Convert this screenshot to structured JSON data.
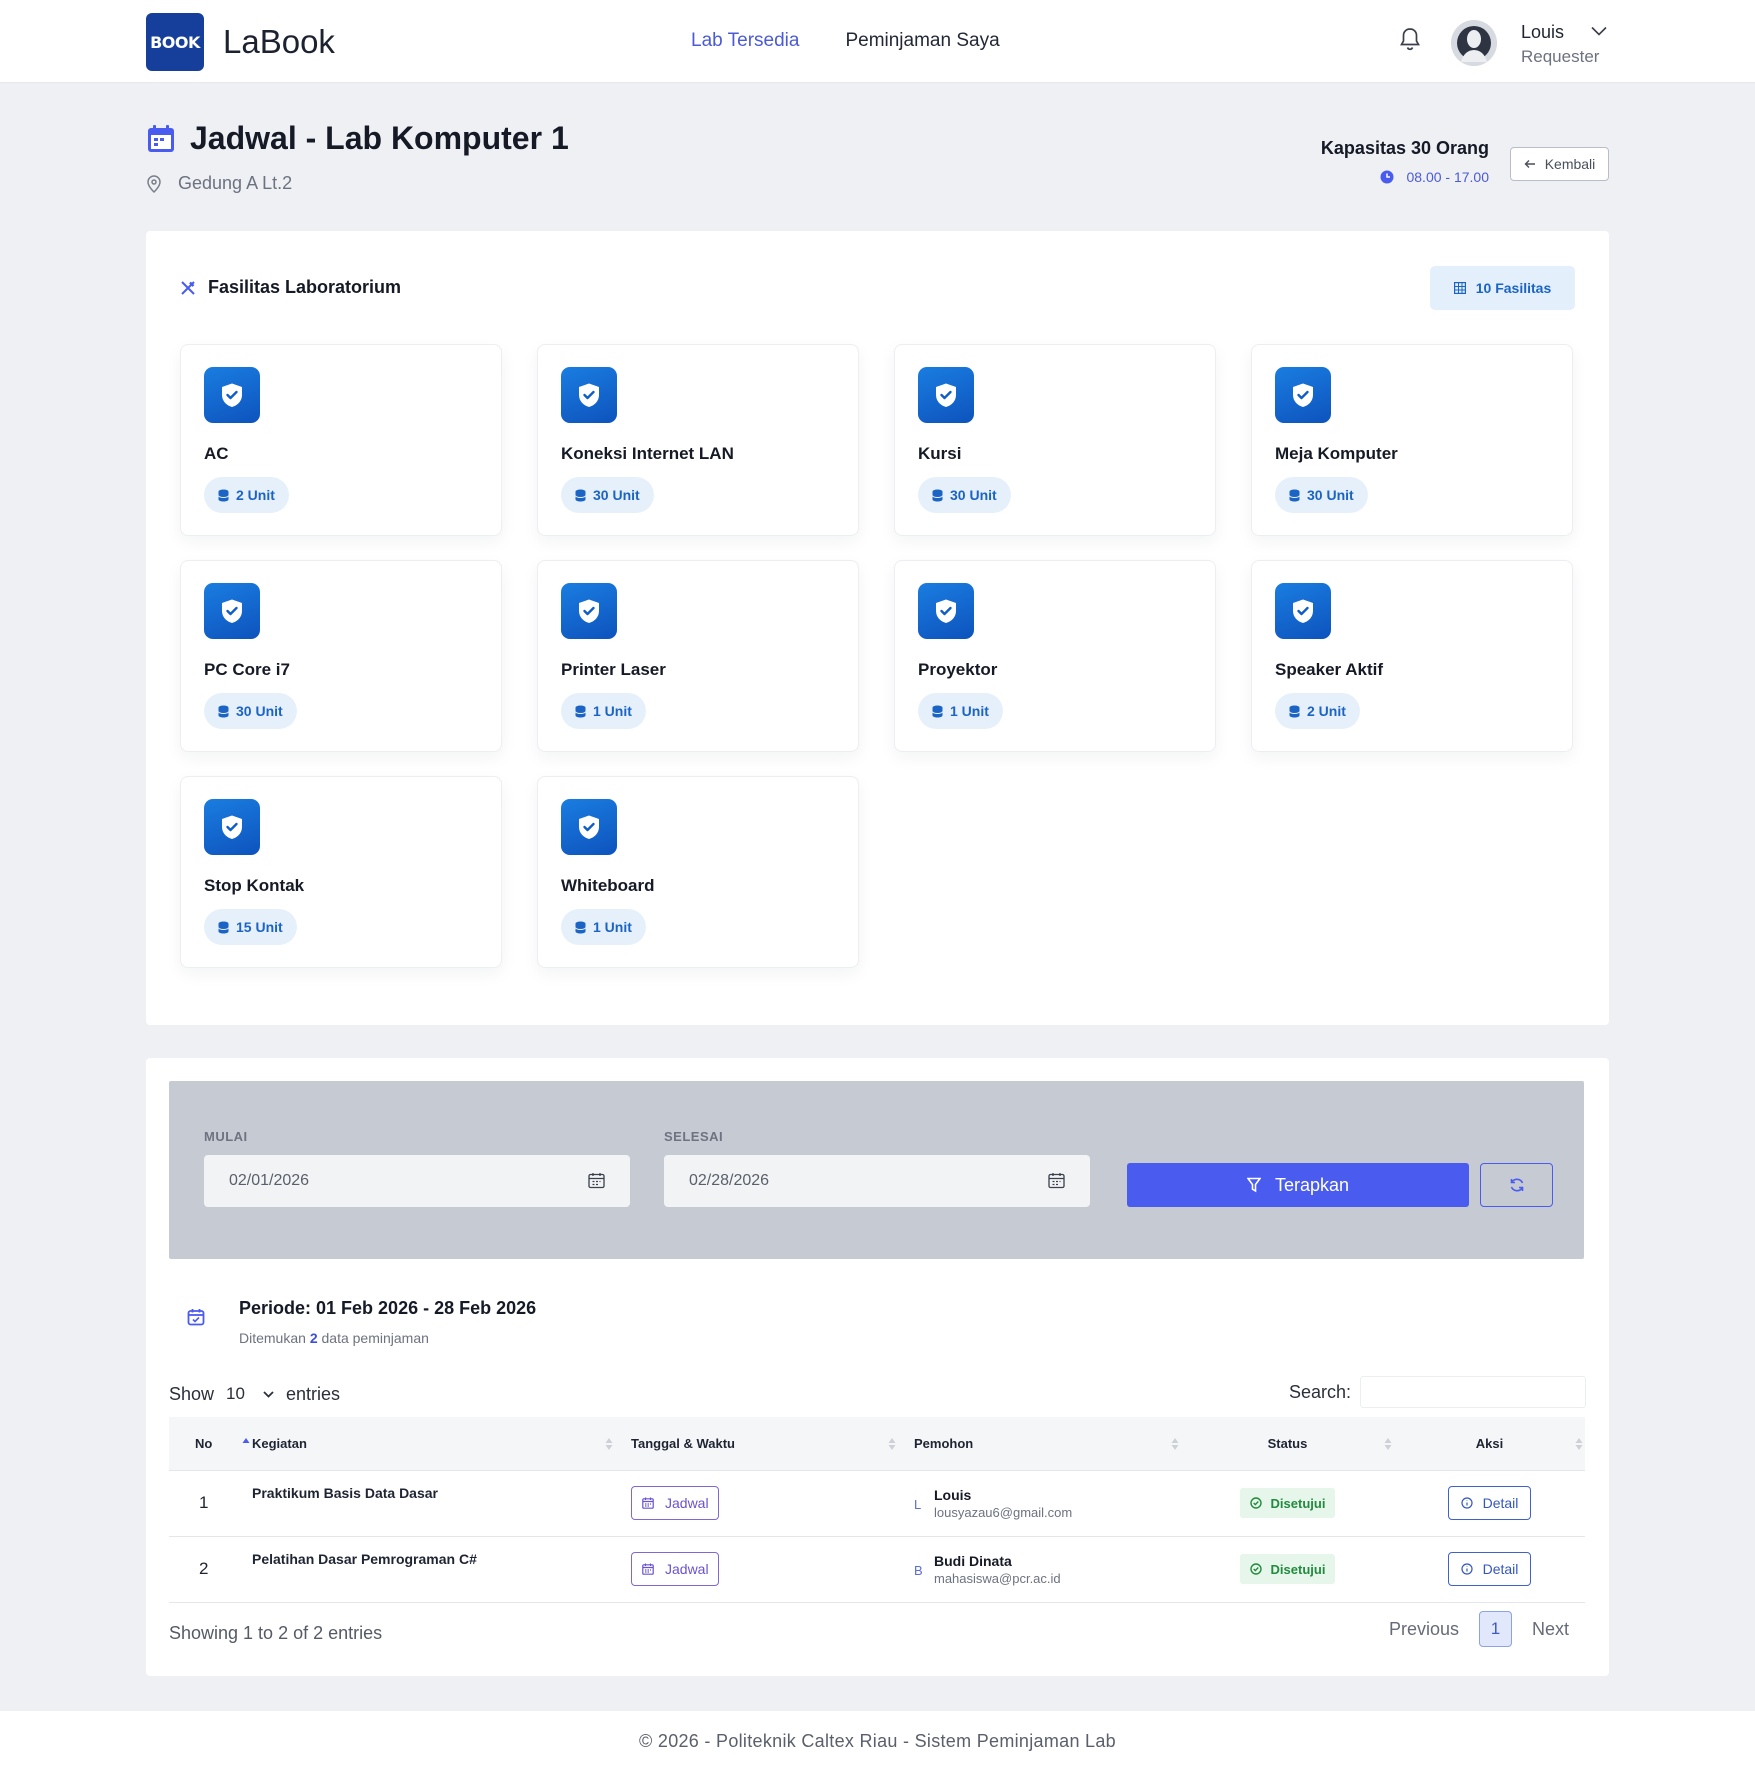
{
  "app": {
    "logo_text": "BOOK",
    "name": "LaBook"
  },
  "nav": {
    "links": [
      {
        "label": "Lab Tersedia",
        "active": true
      },
      {
        "label": "Peminjaman Saya",
        "active": false
      }
    ]
  },
  "user": {
    "name": "Louis",
    "role": "Requester"
  },
  "header": {
    "title": "Jadwal - Lab Komputer 1",
    "location": "Gedung A Lt.2",
    "capacity": "Kapasitas 30 Orang",
    "hours": "08.00 - 17.00",
    "back_label": "Kembali"
  },
  "facilities": {
    "title": "Fasilitas Laboratorium",
    "count_label": "10 Fasilitas",
    "items": [
      {
        "name": "AC",
        "unit": "2 Unit"
      },
      {
        "name": "Koneksi Internet LAN",
        "unit": "30 Unit"
      },
      {
        "name": "Kursi",
        "unit": "30 Unit"
      },
      {
        "name": "Meja Komputer",
        "unit": "30 Unit"
      },
      {
        "name": "PC Core i7",
        "unit": "30 Unit"
      },
      {
        "name": "Printer Laser",
        "unit": "1 Unit"
      },
      {
        "name": "Proyektor",
        "unit": "1 Unit"
      },
      {
        "name": "Speaker Aktif",
        "unit": "2 Unit"
      },
      {
        "name": "Stop Kontak",
        "unit": "15 Unit"
      },
      {
        "name": "Whiteboard",
        "unit": "1 Unit"
      }
    ]
  },
  "filter": {
    "start_label": "MULAI",
    "start_value": "02/01/2026",
    "end_label": "SELESAI",
    "end_value": "02/28/2026",
    "apply_label": "Terapkan"
  },
  "period": {
    "title": "Periode: 01 Feb 2026 - 28 Feb 2026",
    "found_prefix": "Ditemukan",
    "found_count": "2",
    "found_suffix": "data peminjaman"
  },
  "table_controls": {
    "show_label": "Show",
    "show_value": "10",
    "entries_label": "entries",
    "search_label": "Search:"
  },
  "table": {
    "columns": [
      "No",
      "Kegiatan",
      "Tanggal & Waktu",
      "Pemohon",
      "Status",
      "Aksi"
    ],
    "rows": [
      {
        "no": "1",
        "activity": "Praktikum Basis Data Dasar",
        "schedule_label": "Jadwal",
        "initial": "L",
        "requester_name": "Louis",
        "requester_email": "lousyazau6@gmail.com",
        "status": "Disetujui",
        "action": "Detail"
      },
      {
        "no": "2",
        "activity": "Pelatihan Dasar Pemrograman C#",
        "schedule_label": "Jadwal",
        "initial": "B",
        "requester_name": "Budi Dinata",
        "requester_email": "mahasiswa@pcr.ac.id",
        "status": "Disetujui",
        "action": "Detail"
      }
    ]
  },
  "pagination": {
    "info": "Showing 1 to 2 of 2 entries",
    "previous": "Previous",
    "current_page": "1",
    "next": "Next"
  },
  "footer": {
    "text": "© 2026 - Politeknik Caltex Riau - Sistem Peminjaman Lab"
  },
  "colors": {
    "accent": "#4a5bf0",
    "nav_active": "#4b5bd6",
    "facility_icon": "#1166d4",
    "status_green": "#238a3f"
  },
  "icons": {
    "logo": "book-logo-icon",
    "bell": "bell-icon",
    "title": "calendar-icon",
    "location": "map-pin-icon",
    "time": "clock-icon",
    "back": "arrow-left-icon",
    "facilities": "tools-icon",
    "facility_item": "shield-check-icon",
    "unit": "database-icon",
    "filter": "filter-icon",
    "reset": "refresh-icon",
    "detail": "info-circle-icon",
    "status": "check-circle-icon"
  }
}
